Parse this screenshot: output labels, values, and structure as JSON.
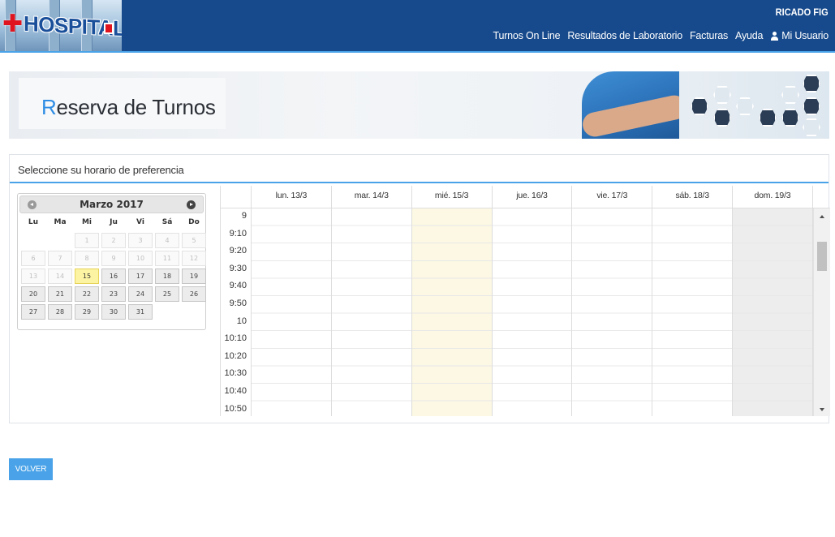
{
  "header": {
    "logo_text": "HOSPITAL",
    "user_name": "RICADO FIG",
    "nav": [
      {
        "label": "Turnos On Line"
      },
      {
        "label": "Resultados de Laboratorio"
      },
      {
        "label": "Facturas"
      },
      {
        "label": "Ayuda"
      },
      {
        "label": "Mi Usuario",
        "icon": "user-icon"
      }
    ],
    "colors": {
      "bar": "#174a8c",
      "accent": "#4aa3e8"
    }
  },
  "banner": {
    "title_first_letter": "R",
    "title_rest": "eserva de Turnos"
  },
  "panel": {
    "heading": "Seleccione su horario de preferencia"
  },
  "mini_calendar": {
    "title": "Marzo 2017",
    "prev_icon": "chevron-left-icon",
    "next_icon": "chevron-right-icon",
    "dows": [
      "Lu",
      "Ma",
      "Mi",
      "Ju",
      "Vi",
      "Sá",
      "Do"
    ],
    "weeks": [
      [
        "",
        "",
        "1",
        "2",
        "3",
        "4",
        "5"
      ],
      [
        "6",
        "7",
        "8",
        "9",
        "10",
        "11",
        "12"
      ],
      [
        "13",
        "14",
        "15",
        "16",
        "17",
        "18",
        "19"
      ],
      [
        "20",
        "21",
        "22",
        "23",
        "24",
        "25",
        "26"
      ],
      [
        "27",
        "28",
        "29",
        "30",
        "31",
        "",
        ""
      ]
    ],
    "today": "15",
    "first_selectable": "15"
  },
  "week": {
    "days": [
      "lun. 13/3",
      "mar. 14/3",
      "mié. 15/3",
      "jue. 16/3",
      "vie. 17/3",
      "sáb. 18/3",
      "dom. 19/3"
    ],
    "today_index": 2,
    "disabled_index": 6,
    "times": [
      "9",
      "9:10",
      "9:20",
      "9:30",
      "9:40",
      "9:50",
      "10",
      "10:10",
      "10:20",
      "10:30",
      "10:40",
      "10:50"
    ]
  },
  "actions": {
    "back_label": "VOLVER"
  }
}
